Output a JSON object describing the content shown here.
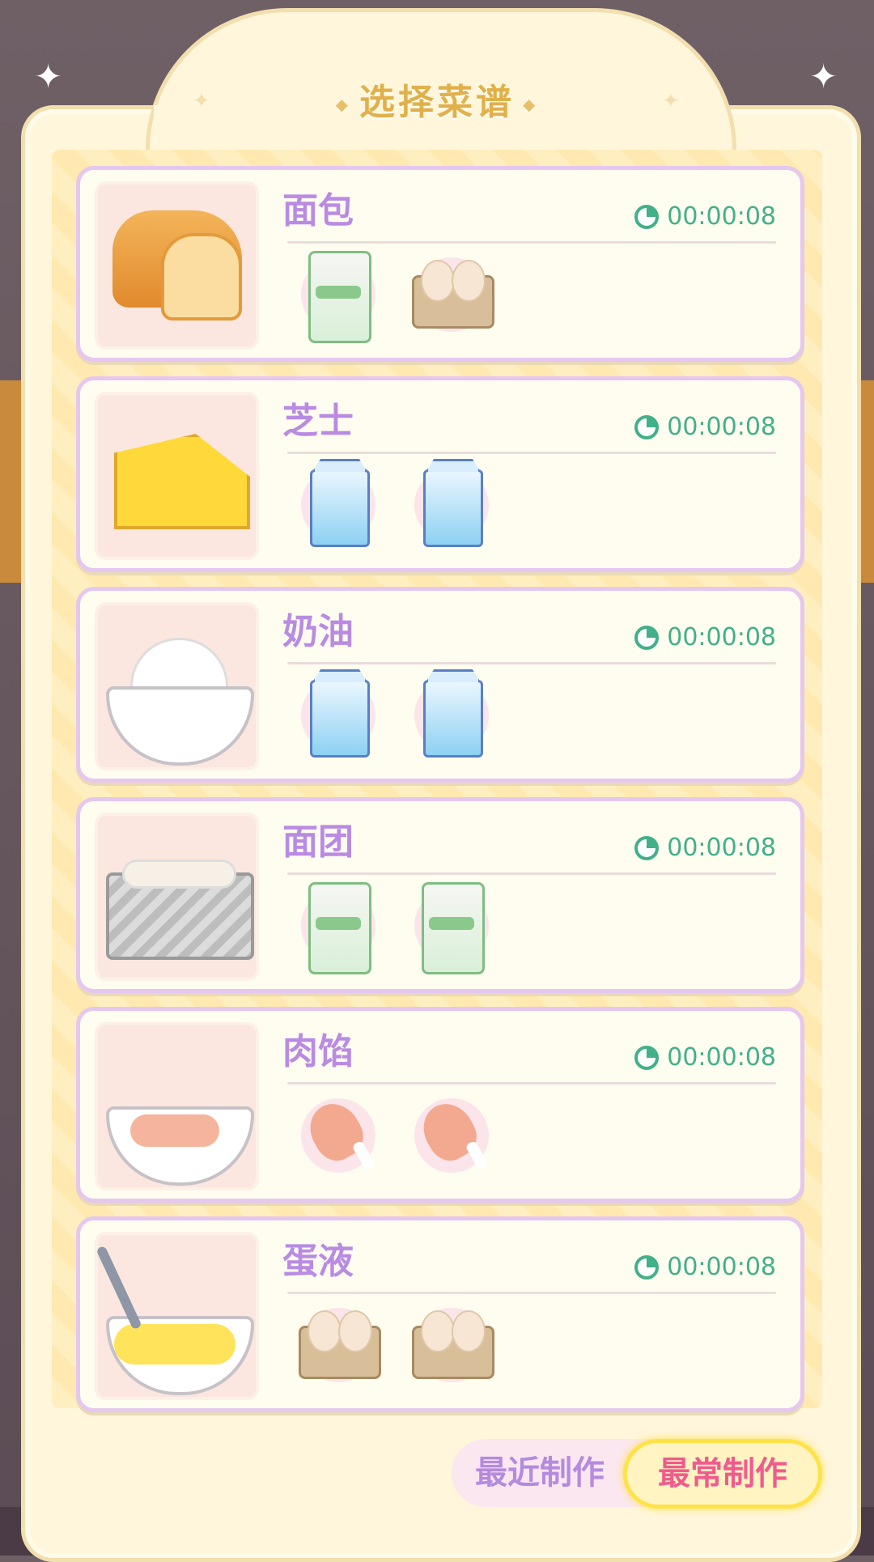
{
  "dialog": {
    "title": "选择菜谱"
  },
  "recipes": [
    {
      "name": "面包",
      "time": "00:00:08",
      "image": "bread",
      "ingredients": [
        "flour-bag",
        "egg-carton"
      ]
    },
    {
      "name": "芝士",
      "time": "00:00:08",
      "image": "cheese",
      "ingredients": [
        "milk-carton",
        "milk-carton"
      ]
    },
    {
      "name": "奶油",
      "time": "00:00:08",
      "image": "cream-bowl",
      "ingredients": [
        "milk-carton",
        "milk-carton"
      ]
    },
    {
      "name": "面团",
      "time": "00:00:08",
      "image": "dough-pan",
      "ingredients": [
        "flour-bag",
        "flour-bag"
      ]
    },
    {
      "name": "肉馅",
      "time": "00:00:08",
      "image": "meat-filling-bowl",
      "ingredients": [
        "chicken-drumstick",
        "chicken-drumstick"
      ]
    },
    {
      "name": "蛋液",
      "time": "00:00:08",
      "image": "egg-liquid-bowl",
      "ingredients": [
        "egg-carton",
        "egg-carton"
      ]
    }
  ],
  "tabs": {
    "recent": "最近制作",
    "frequent": "最常制作",
    "active": "frequent"
  },
  "colors": {
    "recipe_name": "#b98be3",
    "timer": "#42b089",
    "title": "#e0b14a",
    "active_tab_text": "#f05b8d",
    "inactive_tab_text": "#b48bdf"
  }
}
